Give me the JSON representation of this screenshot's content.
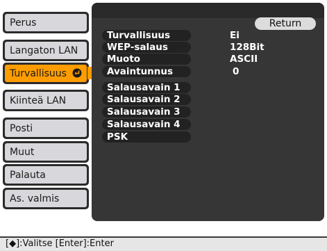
{
  "menu": {
    "items": [
      {
        "label": "Perus"
      },
      {
        "label": "Langaton LAN"
      },
      {
        "label": "Turvallisuus",
        "active": true
      },
      {
        "label": "Kiinteä LAN"
      },
      {
        "label": "Posti"
      },
      {
        "label": "Muut"
      },
      {
        "label": "Palauta"
      },
      {
        "label": "As. valmis"
      }
    ]
  },
  "panel": {
    "return_label": "Return",
    "rows": [
      {
        "label": "Turvallisuus",
        "value": "Ei"
      },
      {
        "label": "WEP-salaus",
        "value": "128Bit"
      },
      {
        "label": "Muoto",
        "value": "ASCII"
      },
      {
        "label": "Avaintunnus",
        "value": "0"
      },
      {
        "label": "Salausavain 1",
        "value": ""
      },
      {
        "label": "Salausavain 2",
        "value": ""
      },
      {
        "label": "Salausavain 3",
        "value": ""
      },
      {
        "label": "Salausavain 4",
        "value": ""
      },
      {
        "label": "PSK",
        "value": ""
      }
    ]
  },
  "status_bar": {
    "select_key": "[◆]",
    "select_text": ":Valitse",
    "enter_key": "[Enter]",
    "enter_text": ":Enter"
  },
  "colors": {
    "active": "#ff9c00",
    "panel": "#363636",
    "menu_face": "#d8d8dc"
  },
  "icons": {
    "enter": "enter-arrow-icon",
    "updown": "up-down-arrow-icon"
  }
}
